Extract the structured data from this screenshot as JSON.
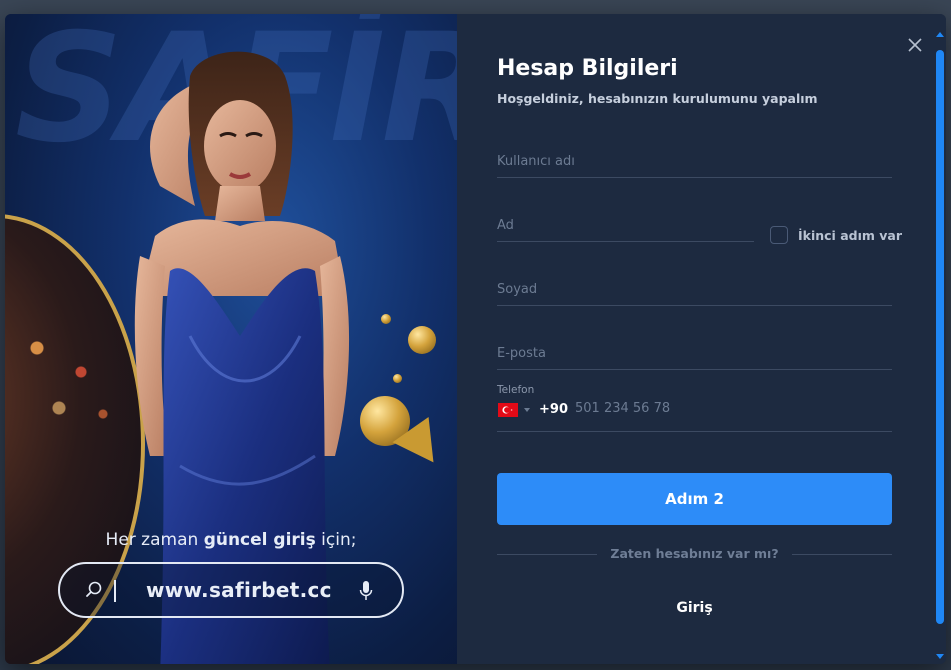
{
  "promo": {
    "brand_watermark": "SAFİR",
    "tagline_prefix": "Her zaman ",
    "tagline_bold": "güncel giriş",
    "tagline_suffix": " için;",
    "url": "www.safirbet.cc",
    "icons": [
      "search-icon",
      "microphone-icon"
    ]
  },
  "form": {
    "title": "Hesap Bilgileri",
    "subtitle": "Hoşgeldiniz, hesabınızın kurulumunu yapalım",
    "fields": {
      "username": {
        "placeholder": "Kullanıcı adı",
        "value": ""
      },
      "name": {
        "placeholder": "Ad",
        "value": ""
      },
      "surname": {
        "placeholder": "Soyad",
        "value": ""
      },
      "email": {
        "placeholder": "E-posta",
        "value": ""
      }
    },
    "second_name_label": "İkinci adım var",
    "phone": {
      "label": "Telefon",
      "country_code": "+90",
      "placeholder": "501 234 56 78",
      "flag": "turkey-flag-icon"
    },
    "submit_label": "Adım 2",
    "have_account_text": "Zaten hesabınız var mı?",
    "login_label": "Giriş"
  },
  "colors": {
    "accent": "#2d8cf8",
    "panel_bg": "#1d2a40",
    "scrollbar": "#1f87f5"
  }
}
